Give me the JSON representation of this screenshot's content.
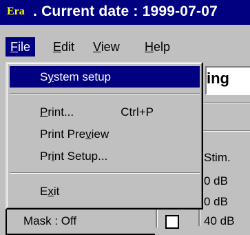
{
  "window": {
    "app_icon_text": "Era",
    "title": ". Current date : 1999-07-07"
  },
  "menubar": {
    "items": [
      {
        "mnemonic": "F",
        "rest": "ile"
      },
      {
        "mnemonic": "E",
        "rest": "dit"
      },
      {
        "mnemonic": "V",
        "rest": "iew"
      },
      {
        "mnemonic": "H",
        "rest": "elp"
      }
    ]
  },
  "file_menu": {
    "system_setup": {
      "pre": "S",
      "mn": "y",
      "post": "stem setup"
    },
    "print": {
      "pre": "",
      "mn": "P",
      "post": "rint...",
      "shortcut": "Ctrl+P"
    },
    "print_preview": {
      "pre": "Print Pre",
      "mn": "v",
      "post": "iew"
    },
    "print_setup": {
      "pre": "Pr",
      "mn": "i",
      "post": "nt Setup..."
    },
    "exit": {
      "pre": "E",
      "mn": "x",
      "post": "it"
    }
  },
  "background": {
    "field_text": "ing",
    "stim_label": "Stim.",
    "db_values": [
      "0 dB",
      "0 dB",
      "40 dB"
    ],
    "mask_label": "Mask : Off"
  },
  "colors": {
    "titlebar": "#000080",
    "highlight": "#000080",
    "face": "#c0c0c0",
    "app_icon": "#ffff00"
  }
}
